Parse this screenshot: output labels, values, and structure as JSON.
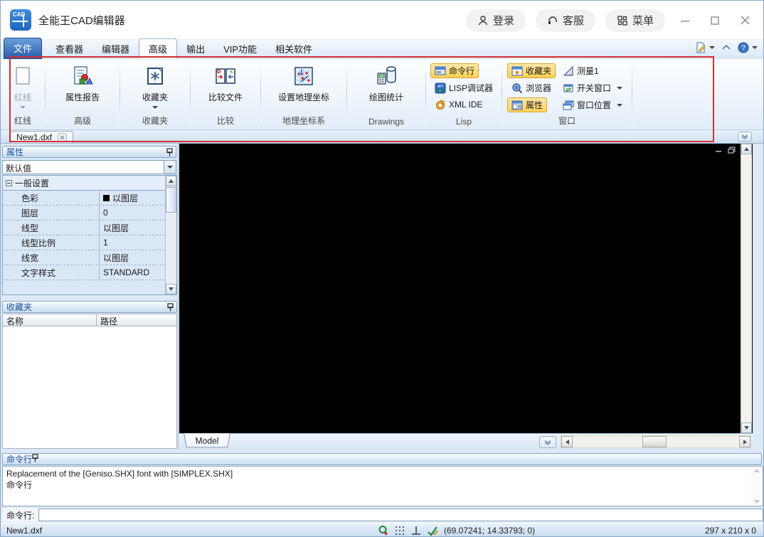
{
  "window": {
    "title": "全能王CAD编辑器",
    "header_buttons": {
      "login": "登录",
      "service": "客服",
      "menu": "菜单"
    }
  },
  "menu_tabs": [
    {
      "label": "文件"
    },
    {
      "label": "查看器"
    },
    {
      "label": "编辑器"
    },
    {
      "label": "高级"
    },
    {
      "label": "输出"
    },
    {
      "label": "VIP功能"
    },
    {
      "label": "相关软件"
    }
  ],
  "ribbon": {
    "groups": [
      {
        "label": "红线",
        "button": "红线"
      },
      {
        "label": "高级",
        "button": "属性报告"
      },
      {
        "label": "收藏夹",
        "button": "收藏夹"
      },
      {
        "label": "比较",
        "button": "比较文件"
      },
      {
        "label": "地理坐标系",
        "button": "设置地理坐标"
      },
      {
        "label": "Drawings",
        "button": "绘图统计"
      },
      {
        "label": "Lisp",
        "buttons": [
          "命令行",
          "LISP调试器",
          "XML IDE"
        ]
      },
      {
        "label": "窗口",
        "col1": [
          "收藏夹",
          "浏览器",
          "属性"
        ],
        "col2": [
          "测量1",
          "开关窗口",
          "窗口位置"
        ]
      }
    ]
  },
  "document_tabs": [
    {
      "label": "New1.dxf"
    }
  ],
  "properties_panel": {
    "title": "属性",
    "preset": "默认值",
    "group_row": "一般设置",
    "rows": [
      {
        "label": "色彩",
        "value": "以图层"
      },
      {
        "label": "图层",
        "value": "0"
      },
      {
        "label": "线型",
        "value": "以图层"
      },
      {
        "label": "线型比例",
        "value": "1"
      },
      {
        "label": "线宽",
        "value": "以图层"
      },
      {
        "label": "文字样式",
        "value": "STANDARD"
      }
    ]
  },
  "favorites_panel": {
    "title": "收藏夹",
    "columns": [
      "名称",
      "路径"
    ]
  },
  "canvas": {
    "model_tab": "Model"
  },
  "command_panel": {
    "title": "命令行",
    "lines": [
      "Replacement of the [Geniso.SHX] font with [SIMPLEX.SHX]",
      "命令行"
    ],
    "prompt_label": "命令行:",
    "input_value": ""
  },
  "status_bar": {
    "file": "New1.dxf",
    "coordinates": "(69.07241; 14.33793; 0)",
    "dimensions": "297 x 210 x 0"
  },
  "colors": {
    "accent_blue": "#2a5caa",
    "toggle_orange": "#ffd257",
    "annotation_red": "#d43030",
    "canvas_black": "#000000"
  }
}
